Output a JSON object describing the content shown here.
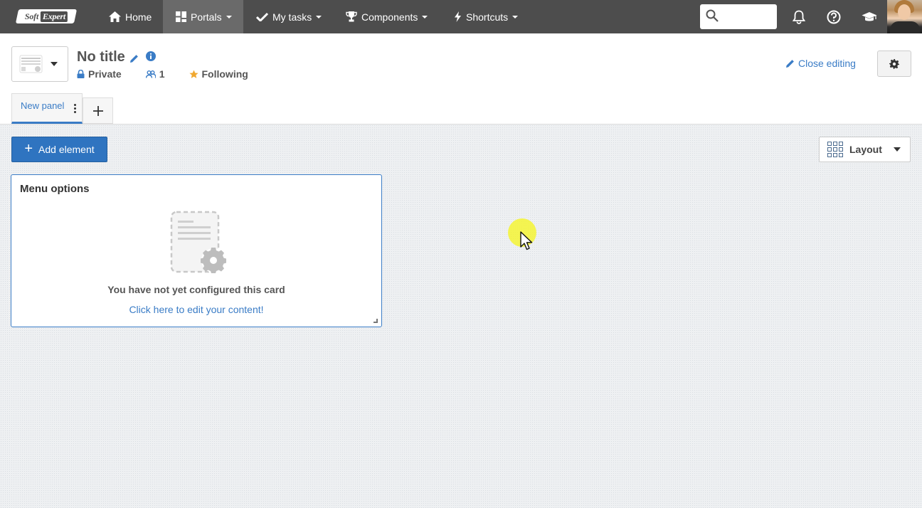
{
  "brand": {
    "left": "Soft",
    "right": "Expert"
  },
  "nav": {
    "home": "Home",
    "portals": "Portals",
    "my_tasks": "My tasks",
    "components": "Components",
    "shortcuts": "Shortcuts"
  },
  "search": {
    "placeholder": "",
    "value": ""
  },
  "header": {
    "title": "No title",
    "privacy": "Private",
    "members": "1",
    "following": "Following",
    "close_editing": "Close editing"
  },
  "tabs": [
    {
      "label": "New panel"
    }
  ],
  "toolbar": {
    "add_element": "Add element",
    "layout": "Layout"
  },
  "card": {
    "title": "Menu options",
    "message": "You have not yet configured this card",
    "link": "Click here to edit your content!"
  },
  "colors": {
    "navbar": "#4d4d4d",
    "accent": "#2f74c0",
    "link": "#3a7cc6",
    "star": "#f0a830"
  },
  "icons": [
    "home-icon",
    "portals-icon",
    "check-icon",
    "trophy-icon",
    "bolt-icon",
    "search-icon",
    "bell-icon",
    "help-icon",
    "graduation-cap-icon",
    "pencil-icon",
    "info-icon",
    "lock-icon",
    "users-icon",
    "star-icon",
    "gear-icon",
    "plus-icon",
    "grid-icon",
    "kebab-icon"
  ]
}
